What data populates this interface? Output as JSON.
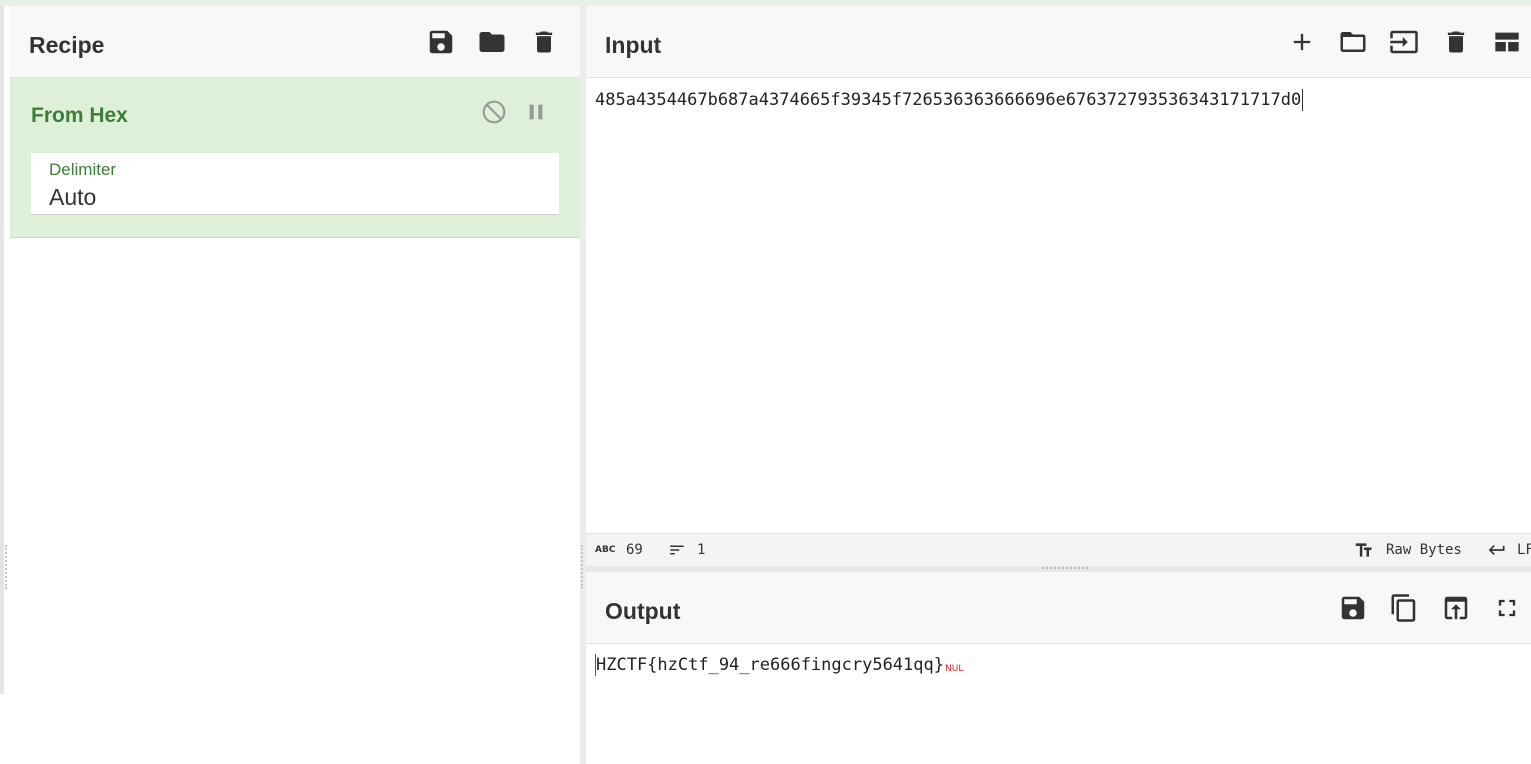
{
  "recipe": {
    "title": "Recipe",
    "icons": [
      "save-icon",
      "folder-icon",
      "trash-icon"
    ],
    "operation": {
      "name": "From Hex",
      "icons": [
        "disable-icon",
        "pause-icon"
      ],
      "arg_label": "Delimiter",
      "arg_value": "Auto"
    }
  },
  "input": {
    "title": "Input",
    "icons": [
      "plus-icon",
      "folder-icon",
      "import-icon",
      "trash-icon",
      "layout-icon"
    ],
    "text": "485a4354467b687a4374665f39345f726536363666696e676372793536343171717d0"
  },
  "status": {
    "abc_icon": "ABC",
    "length": "69",
    "lines": "1",
    "encoding": "Raw Bytes",
    "eol": "LF"
  },
  "output": {
    "title": "Output",
    "icons": [
      "save-icon",
      "copy-icon",
      "replace-input-icon",
      "maximise-icon"
    ],
    "text": "HZCTF{hzCtf_94_re666fingcry5641qq}",
    "nul_marker": "NUL"
  },
  "colors": {
    "accent_green": "#3c7d3c",
    "op_background": "#dff0d8",
    "nul_red": "#d42020"
  }
}
